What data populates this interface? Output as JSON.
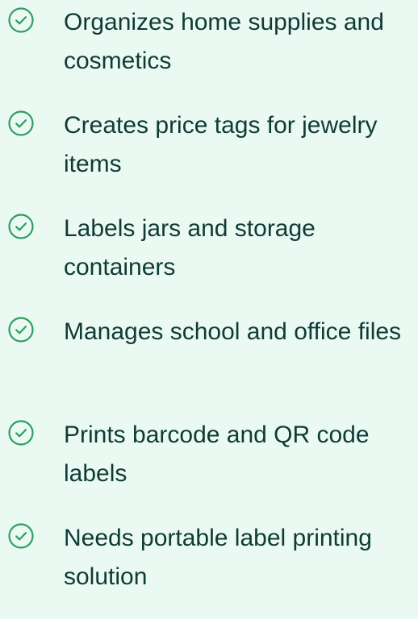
{
  "features": {
    "icon": "check-circle-icon",
    "accent_color": "#2e9e5f",
    "text_color": "#103a35",
    "background_color": "#eafaf3",
    "items": [
      {
        "label": "Organizes home supplies and cosmetics"
      },
      {
        "label": "Creates price tags for jewelry items"
      },
      {
        "label": "Labels jars and storage containers"
      },
      {
        "label": "Manages school and office files"
      },
      {
        "label": "Prints barcode and QR code labels"
      },
      {
        "label": "Needs portable label printing solution"
      }
    ]
  }
}
